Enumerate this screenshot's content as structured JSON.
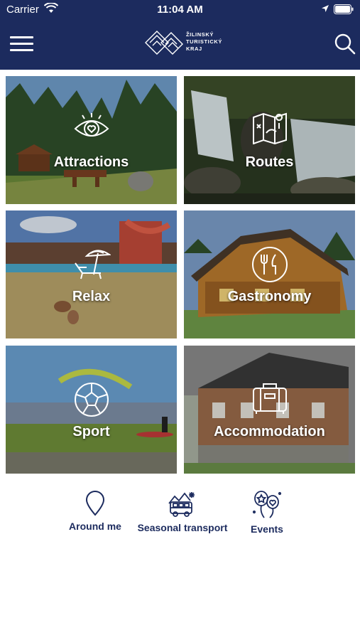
{
  "status_bar": {
    "carrier": "Carrier",
    "time": "11:04 AM"
  },
  "header": {
    "logo_lines": [
      "ŽILINSKÝ",
      "TURISTICKÝ",
      "KRAJ"
    ],
    "menu_icon": "hamburger-menu-icon",
    "search_icon": "search-icon"
  },
  "tiles": [
    {
      "label": "Attractions",
      "icon": "eye-heart-icon"
    },
    {
      "label": "Routes",
      "icon": "map-icon"
    },
    {
      "label": "Relax",
      "icon": "beach-umbrella-icon"
    },
    {
      "label": "Gastronomy",
      "icon": "fork-knife-icon"
    },
    {
      "label": "Sport",
      "icon": "ball-icon"
    },
    {
      "label": "Accommodation",
      "icon": "suitcase-icon"
    }
  ],
  "quick_links": [
    {
      "label": "Around me",
      "icon": "location-pin-icon"
    },
    {
      "label": "Seasonal transport",
      "icon": "bus-icon"
    },
    {
      "label": "Events",
      "icon": "balloons-icon"
    }
  ],
  "colors": {
    "header_bg": "#1c2b5e",
    "accent_text": "#1c2b5e",
    "tile_text": "#ffffff"
  }
}
